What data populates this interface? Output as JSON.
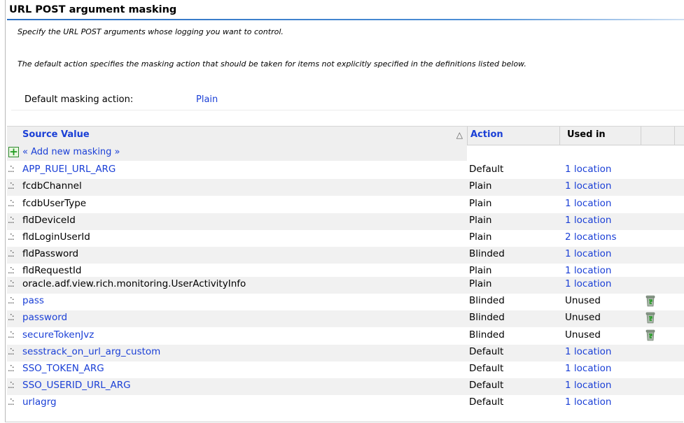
{
  "panel": {
    "title": "URL POST argument masking",
    "description_1": "Specify the URL POST arguments whose logging you want to control.",
    "description_2": "The default action specifies the masking action that should be taken for items not explicitly specified in the definitions listed below.",
    "default_label": "Default masking action:",
    "default_value": "Plain"
  },
  "grid": {
    "columns": {
      "source": "Source Value",
      "sort_indicator": "△",
      "action": "Action",
      "used_in": "Used in"
    },
    "add_label": "« Add new masking »",
    "rows": [
      {
        "source": "APP_RUEI_URL_ARG",
        "action": "Default",
        "used": "1 location",
        "source_link": true,
        "trash": false
      },
      {
        "source": "fcdbChannel",
        "action": "Plain",
        "used": "1 location",
        "source_link": false,
        "trash": false
      },
      {
        "source": "fcdbUserType",
        "action": "Plain",
        "used": "1 location",
        "source_link": false,
        "trash": false
      },
      {
        "source": "fldDeviceId",
        "action": "Plain",
        "used": "1 location",
        "source_link": false,
        "trash": false
      },
      {
        "source": "fldLoginUserId",
        "action": "Plain",
        "used": "2 locations",
        "source_link": false,
        "trash": false
      },
      {
        "source": "fldPassword",
        "action": "Blinded",
        "used": "1 location",
        "source_link": false,
        "trash": false
      },
      {
        "source": "fldRequestId",
        "action": "Plain",
        "used": "1 location",
        "source_link": false,
        "trash": false
      },
      {
        "source": "oracle.adf.view.rich.monitoring.UserActivityInfo",
        "action": "Plain",
        "used": "1 location",
        "source_link": false,
        "trash": false
      },
      {
        "source": "pass",
        "action": "Blinded",
        "used": "Unused",
        "source_link": true,
        "trash": true
      },
      {
        "source": "password",
        "action": "Blinded",
        "used": "Unused",
        "source_link": true,
        "trash": true
      },
      {
        "source": "secureTokenJvz",
        "action": "Blinded",
        "used": "Unused",
        "source_link": true,
        "trash": true
      },
      {
        "source": "sesstrack_on_url_arg_custom",
        "action": "Default",
        "used": "1 location",
        "source_link": true,
        "trash": false
      },
      {
        "source": "SSO_TOKEN_ARG",
        "action": "Default",
        "used": "1 location",
        "source_link": true,
        "trash": false
      },
      {
        "source": "SSO_USERID_URL_ARG",
        "action": "Default",
        "used": "1 location",
        "source_link": true,
        "trash": false
      },
      {
        "source": "urlagrg",
        "action": "Default",
        "used": "1 location",
        "source_link": true,
        "trash": false
      }
    ]
  },
  "colors": {
    "link": "#1a3fd6",
    "header_bg": "#efefef",
    "alt_row": "#f1f1f1"
  },
  "icons": {
    "add": "add-plus-icon",
    "drag": "drag-handle-icon",
    "delete": "trash-icon"
  }
}
